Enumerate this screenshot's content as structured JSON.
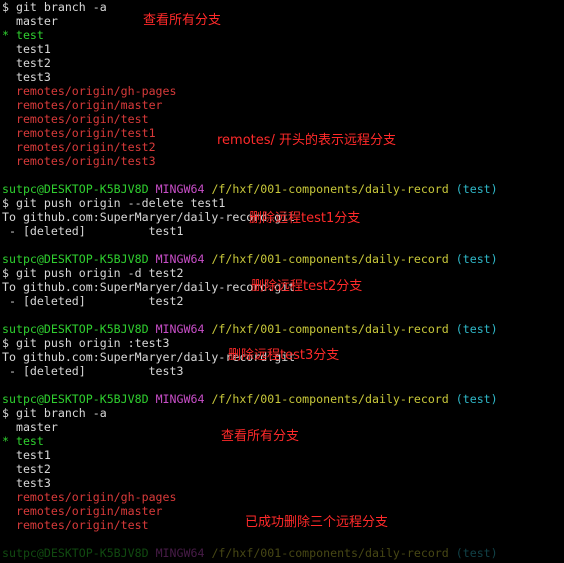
{
  "prompt": {
    "user_host": "sutpc@DESKTOP-K5BJV8D",
    "shell": "MINGW64",
    "path": "/f/hxf/001-components/daily-record",
    "branch": "(test)"
  },
  "block1": {
    "command": "$ git branch -a",
    "local_branches": [
      "  master",
      "* test",
      "  test1",
      "  test2",
      "  test3"
    ],
    "remote_branches": [
      "  remotes/origin/gh-pages",
      "  remotes/origin/master",
      "  remotes/origin/test",
      "  remotes/origin/test1",
      "  remotes/origin/test2",
      "  remotes/origin/test3"
    ]
  },
  "block2": {
    "command": "$ git push origin --delete test1",
    "to_line": "To github.com:SuperMaryer/daily-record.git",
    "result": " - [deleted]         test1"
  },
  "block3": {
    "command": "$ git push origin -d test2",
    "to_line": "To github.com:SuperMaryer/daily-record.git",
    "result": " - [deleted]         test2"
  },
  "block4": {
    "command": "$ git push origin :test3",
    "to_line": "To github.com:SuperMaryer/daily-record.git",
    "result": " - [deleted]         test3"
  },
  "block5": {
    "command": "$ git branch -a",
    "local_branches": [
      "  master",
      "* test",
      "  test1",
      "  test2",
      "  test3"
    ],
    "remote_branches": [
      "  remotes/origin/gh-pages",
      "  remotes/origin/master",
      "  remotes/origin/test"
    ]
  },
  "annotations": {
    "view_all_1": "查看所有分支",
    "remotes_note": "remotes/ 开头的表示远程分支",
    "delete_test1": "删除远程test1分支",
    "delete_test2": "删除远程test2分支",
    "delete_test3": "删除远程test3分支",
    "view_all_2": "查看所有分支",
    "success_note": "已成功删除三个远程分支"
  },
  "colors": {
    "background": "#000000",
    "prompt_user": "#2fd02f",
    "prompt_shell": "#c84ec8",
    "prompt_path": "#c8c83a",
    "prompt_branch": "#2fb8c8",
    "text": "#d8d8d8",
    "remote_branch": "#d83a3a",
    "annotation": "#ff2a2a"
  }
}
